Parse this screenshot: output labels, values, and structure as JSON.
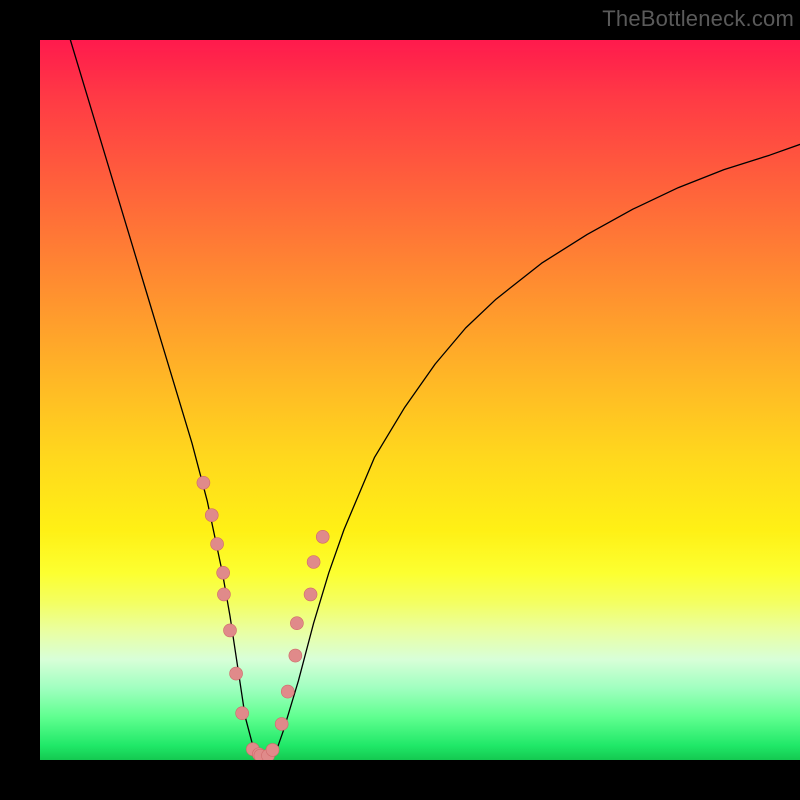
{
  "watermark": {
    "text": "TheBottleneck.com"
  },
  "chart_data": {
    "type": "line",
    "title": "",
    "xlabel": "",
    "ylabel": "",
    "xlim": [
      0,
      100
    ],
    "ylim": [
      0,
      100
    ],
    "grid": false,
    "legend": false,
    "background_gradient": {
      "direction": "vertical",
      "stops": [
        {
          "pos": 0,
          "color": "#ff1a4d"
        },
        {
          "pos": 50,
          "color": "#ffd81d"
        },
        {
          "pos": 80,
          "color": "#f4ff60"
        },
        {
          "pos": 100,
          "color": "#14c850"
        }
      ]
    },
    "series": [
      {
        "name": "curve",
        "color": "#000000",
        "stroke_width": 1.3,
        "x": [
          4,
          6,
          8,
          10,
          12,
          14,
          16,
          18,
          20,
          22,
          23,
          24,
          25,
          26,
          27,
          28,
          29,
          30,
          31,
          32,
          34,
          36,
          38,
          40,
          44,
          48,
          52,
          56,
          60,
          66,
          72,
          78,
          84,
          90,
          96,
          100
        ],
        "y": [
          100,
          93,
          86,
          79,
          72,
          65,
          58,
          51,
          44,
          36,
          31,
          26,
          20,
          13,
          6,
          2,
          0.5,
          0.4,
          1,
          4,
          11,
          19,
          26,
          32,
          42,
          49,
          55,
          60,
          64,
          69,
          73,
          76.5,
          79.5,
          82,
          84,
          85.5
        ]
      }
    ],
    "markers": {
      "name": "dots",
      "color_fill": "#e08a8a",
      "color_stroke": "#d06a6a",
      "radius": 6.5,
      "x": [
        21.5,
        22.6,
        23.3,
        24.1,
        24.2,
        25.0,
        25.8,
        26.6,
        28.0,
        28.8,
        29.0,
        30.0,
        30.6,
        31.8,
        32.6,
        33.6,
        33.8,
        35.6,
        36.0,
        37.2
      ],
      "y": [
        38.5,
        34.0,
        30.0,
        26.0,
        23.0,
        18.0,
        12.0,
        6.5,
        1.5,
        0.8,
        0.6,
        0.6,
        1.4,
        5.0,
        9.5,
        14.5,
        19.0,
        23.0,
        27.5,
        31.0
      ]
    }
  }
}
